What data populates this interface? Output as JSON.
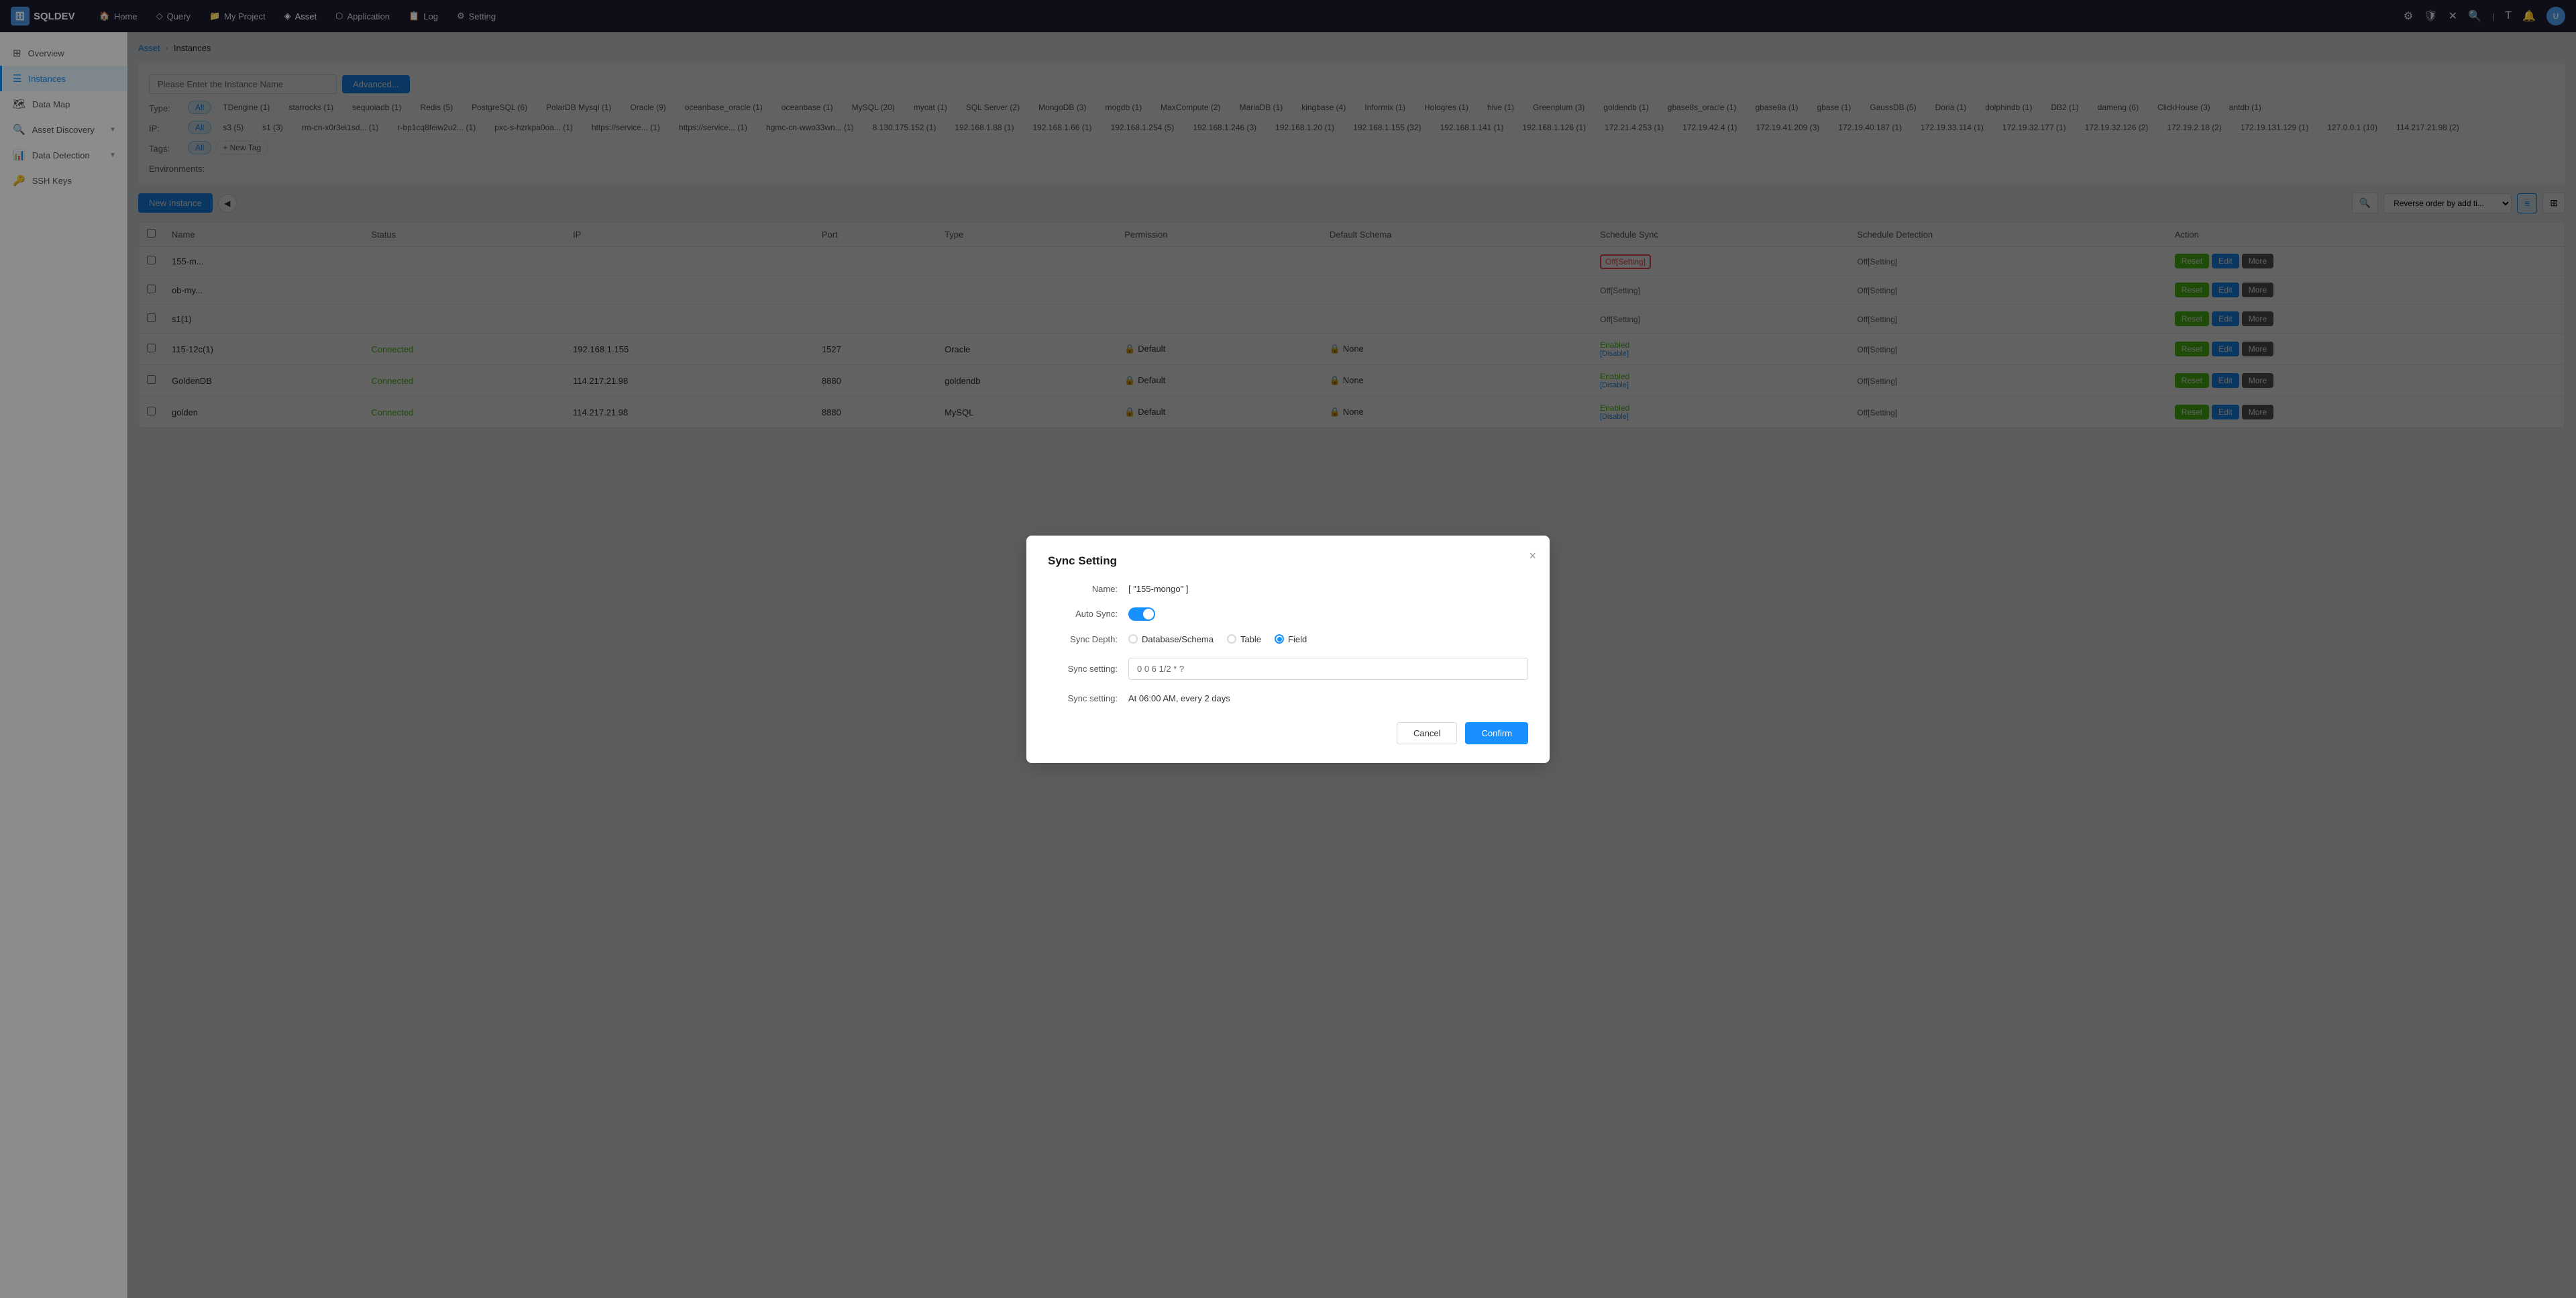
{
  "app": {
    "logo": "SQLDEV",
    "logo_icon": "🗄"
  },
  "topnav": {
    "items": [
      {
        "label": "Home",
        "icon": "🏠",
        "active": false
      },
      {
        "label": "Query",
        "icon": "◇",
        "active": false
      },
      {
        "label": "My Project",
        "icon": "📁",
        "active": false
      },
      {
        "label": "Asset",
        "icon": "◈",
        "active": true
      },
      {
        "label": "Application",
        "icon": "⬡",
        "active": false
      },
      {
        "label": "Log",
        "icon": "📋",
        "active": false
      },
      {
        "label": "Setting",
        "icon": "⚙",
        "active": false
      }
    ]
  },
  "sidebar": {
    "items": [
      {
        "label": "Overview",
        "icon": "⊞",
        "active": false
      },
      {
        "label": "Instances",
        "icon": "☰",
        "active": true
      },
      {
        "label": "Data Map",
        "icon": "🗺",
        "active": false
      },
      {
        "label": "Asset Discovery",
        "icon": "🔍",
        "active": false,
        "has_arrow": true
      },
      {
        "label": "Data Detection",
        "icon": "📊",
        "active": false,
        "has_arrow": true
      },
      {
        "label": "SSH Keys",
        "icon": "🔑",
        "active": false
      }
    ]
  },
  "breadcrumb": {
    "parent": "Asset",
    "current": "Instances"
  },
  "filter": {
    "search_placeholder": "Please Enter the Instance Name",
    "advanced_label": "Advanced...",
    "type_label": "Type:",
    "ip_label": "IP:",
    "tags_label": "Tags:",
    "env_label": "Environments:",
    "all_label": "All",
    "new_tag_label": "+ New Tag",
    "type_filters": [
      {
        "label": "All",
        "active": true
      },
      {
        "label": "TDengine (1)"
      },
      {
        "label": "starrocks (1)"
      },
      {
        "label": "sequoiadb (1)"
      },
      {
        "label": "Redis (5)"
      },
      {
        "label": "PostgreSQL (6)"
      },
      {
        "label": "PolarDB Mysql (1)"
      },
      {
        "label": "Oracle (9)"
      },
      {
        "label": "oceanbase_oracle (1)"
      },
      {
        "label": "oceanbase (1)"
      },
      {
        "label": "MySQL (20)"
      },
      {
        "label": "mycat (1)"
      },
      {
        "label": "SQL Server (2)"
      },
      {
        "label": "MongoDB (3)"
      },
      {
        "label": "mogdb (1)"
      },
      {
        "label": "MaxCompute (2)"
      },
      {
        "label": "MariaDB (1)"
      },
      {
        "label": "kingbase (4)"
      },
      {
        "label": "Informix (1)"
      },
      {
        "label": "Hologres (1)"
      },
      {
        "label": "hive (1)"
      },
      {
        "label": "Greenplum (3)"
      },
      {
        "label": "goldendb (1)"
      },
      {
        "label": "gbase8s_oracle (1)"
      },
      {
        "label": "gbase8a (1)"
      },
      {
        "label": "gbase (1)"
      },
      {
        "label": "GaussDB (5)"
      },
      {
        "label": "Doria (1)"
      },
      {
        "label": "dolphindb (1)"
      },
      {
        "label": "DB2 (1)"
      },
      {
        "label": "dameng (6)"
      },
      {
        "label": "ClickHouse (3)"
      },
      {
        "label": "antdb (1)"
      }
    ],
    "ip_filters": [
      {
        "label": "All",
        "active": true
      },
      {
        "label": "s3 (5)"
      },
      {
        "label": "s1 (3)"
      },
      {
        "label": "rm-cn-x0r3ei1sd... (1)"
      },
      {
        "label": "r-bp1cq8feiw2u2... (1)"
      },
      {
        "label": "pxc-s-hzrkpa0oa... (1)"
      },
      {
        "label": "https://service... (1)"
      },
      {
        "label": "https://service... (1)"
      },
      {
        "label": "hgmc-cn-wwo33wn... (1)"
      },
      {
        "label": "8.130.175.152 (1)"
      },
      {
        "label": "192.168.1.88 (1)"
      },
      {
        "label": "192.168.1.66 (1)"
      },
      {
        "label": "192.168.1.254 (5)"
      },
      {
        "label": "192.168.1.246 (3)"
      },
      {
        "label": "192.168.1.20 (1)"
      },
      {
        "label": "192.168.1.155 (32)"
      },
      {
        "label": "192.168.1.141 (1)"
      },
      {
        "label": "192.168.1.126 (1)"
      },
      {
        "label": "172.21.4.253 (1)"
      },
      {
        "label": "172.19.42.4 (1)"
      },
      {
        "label": "172.19.41.209 (3)"
      },
      {
        "label": "172.19.40.187 (1)"
      },
      {
        "label": "172.19.33.114 (1)"
      },
      {
        "label": "172.19.32.177 (1)"
      },
      {
        "label": "172.19.32.126 (2)"
      },
      {
        "label": "172.19.2.18 (2)"
      },
      {
        "label": "172.19.131.129 (1)"
      },
      {
        "label": "127.0.0.1 (10)"
      },
      {
        "label": "114.217.21.98 (2)"
      }
    ]
  },
  "toolbar": {
    "new_instance_label": "New Instance",
    "sort_label": "Reverse order by add ti...",
    "view_list": "≡",
    "view_grid": "⊞",
    "search_icon": "🔍"
  },
  "table": {
    "columns": [
      "",
      "Name",
      "Status",
      "IP",
      "Port",
      "Type",
      "Permission",
      "Default Schema",
      "Schedule Sync",
      "Schedule Detection",
      "Action"
    ],
    "rows": [
      {
        "name": "155-m...",
        "status": "",
        "ip": "",
        "port": "",
        "type": "",
        "permission": "",
        "default_schema": "",
        "schedule_sync": "Off[Setting]",
        "schedule_sync_highlight": true,
        "schedule_detect": "Off[Setting]",
        "actions": [
          "Reset",
          "Edit",
          "More"
        ]
      },
      {
        "name": "ob-my...",
        "status": "",
        "ip": "",
        "port": "",
        "type": "",
        "permission": "",
        "default_schema": "",
        "schedule_sync": "Off[Setting]",
        "schedule_sync_highlight": false,
        "schedule_detect": "Off[Setting]",
        "actions": [
          "Reset",
          "Edit",
          "More"
        ]
      },
      {
        "name": "s1(1)",
        "status": "",
        "ip": "",
        "port": "",
        "type": "",
        "permission": "",
        "default_schema": "",
        "schedule_sync": "Off[Setting]",
        "schedule_sync_highlight": false,
        "schedule_detect": "Off[Setting]",
        "actions": [
          "Reset",
          "Edit",
          "More"
        ]
      },
      {
        "name": "115-12c(1)",
        "status": "Connected",
        "ip": "192.168.1.155",
        "port": "1527",
        "type": "Oracle",
        "permission": "Default",
        "default_schema": "None",
        "schedule_sync_label": "Enabled",
        "schedule_sync_sub": "[Disable]",
        "schedule_sync_highlight": false,
        "schedule_detect": "Off[Setting]",
        "actions": [
          "Reset",
          "Edit",
          "More"
        ]
      },
      {
        "name": "GoldenDB",
        "status": "Connected",
        "ip": "114.217.21.98",
        "port": "8880",
        "type": "goldendb",
        "permission": "Default",
        "default_schema": "None",
        "schedule_sync_label": "Enabled",
        "schedule_sync_sub": "[Disable]",
        "schedule_sync_highlight": false,
        "schedule_detect": "Off[Setting]",
        "actions": [
          "Reset",
          "Edit",
          "More"
        ]
      },
      {
        "name": "golden",
        "status": "Connected",
        "ip": "114.217.21.98",
        "port": "8880",
        "type": "MySQL",
        "permission": "Default",
        "default_schema": "None",
        "schedule_sync_label": "Enabled",
        "schedule_sync_sub": "[Disable]",
        "schedule_sync_highlight": false,
        "schedule_detect": "Off[Setting]",
        "actions": [
          "Reset",
          "Edit",
          "More"
        ]
      }
    ]
  },
  "modal": {
    "title": "Sync Setting",
    "close_icon": "×",
    "name_label": "Name:",
    "name_value": "[ \"155-mongo\" ]",
    "auto_sync_label": "Auto Sync:",
    "auto_sync_on": true,
    "sync_depth_label": "Sync Depth:",
    "sync_depth_options": [
      {
        "label": "Database/Schema",
        "value": "database_schema",
        "checked": false
      },
      {
        "label": "Table",
        "value": "table",
        "checked": false
      },
      {
        "label": "Field",
        "value": "field",
        "checked": true
      }
    ],
    "sync_setting_label": "Sync setting:",
    "sync_cron_value": "0 0 6 1/2 * ?",
    "sync_setting2_label": "Sync setting:",
    "sync_cron_human": "At 06:00 AM, every 2 days",
    "cancel_label": "Cancel",
    "confirm_label": "Confirm"
  }
}
